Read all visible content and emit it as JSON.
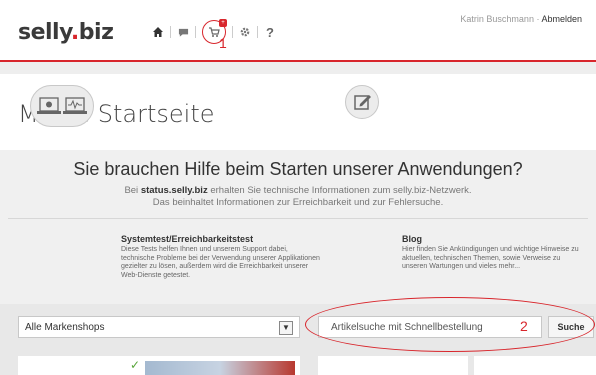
{
  "header": {
    "logo_main": "selly",
    "logo_dot": ".",
    "logo_tld": "biz",
    "nav_icons": [
      "home-icon",
      "chat-icon",
      "cart-icon",
      "gear-icon",
      "help-icon"
    ],
    "help_mark": "?",
    "user_name": "Katrin Buschmann",
    "user_sep": " · ",
    "logout_label": "Abmelden"
  },
  "annotations": {
    "label_1": "1",
    "label_2": "2"
  },
  "page": {
    "title": "Meine Startseite"
  },
  "help": {
    "heading": "Sie brauchen Hilfe beim Starten unserer Anwendungen?",
    "sub_prefix": "Bei ",
    "sub_bold": "status.selly.biz",
    "sub_line1_rest": " erhalten Sie technische Informationen zum selly.biz-Netzwerk.",
    "sub_line2": "Das beinhaltet Informationen zur Erreichbarkeit und zur Fehlersuche.",
    "systemtest": {
      "title": "Systemtest/Erreichbarkeitstest",
      "text": "Diese Tests helfen Ihnen und unserem Support dabei, technische Probleme bei der Verwendung unserer Applikationen gezielter zu lösen, außerdem wird die Erreichbarkeit unserer Web-Dienste getestet."
    },
    "blog": {
      "title": "Blog",
      "text": "Hier finden Sie Ankündigungen und wichtige Hinweise zu aktuellen, technischen Themen, sowie Verweise zu unseren Wartungen und vieles mehr..."
    }
  },
  "shops": {
    "selected": "Alle Markenshops"
  },
  "search": {
    "placeholder": "Artikelsuche mit Schnellbestellung",
    "button_label": "Suche"
  },
  "colors": {
    "accent": "#d8262c",
    "background_band": "#f0f0f0"
  }
}
